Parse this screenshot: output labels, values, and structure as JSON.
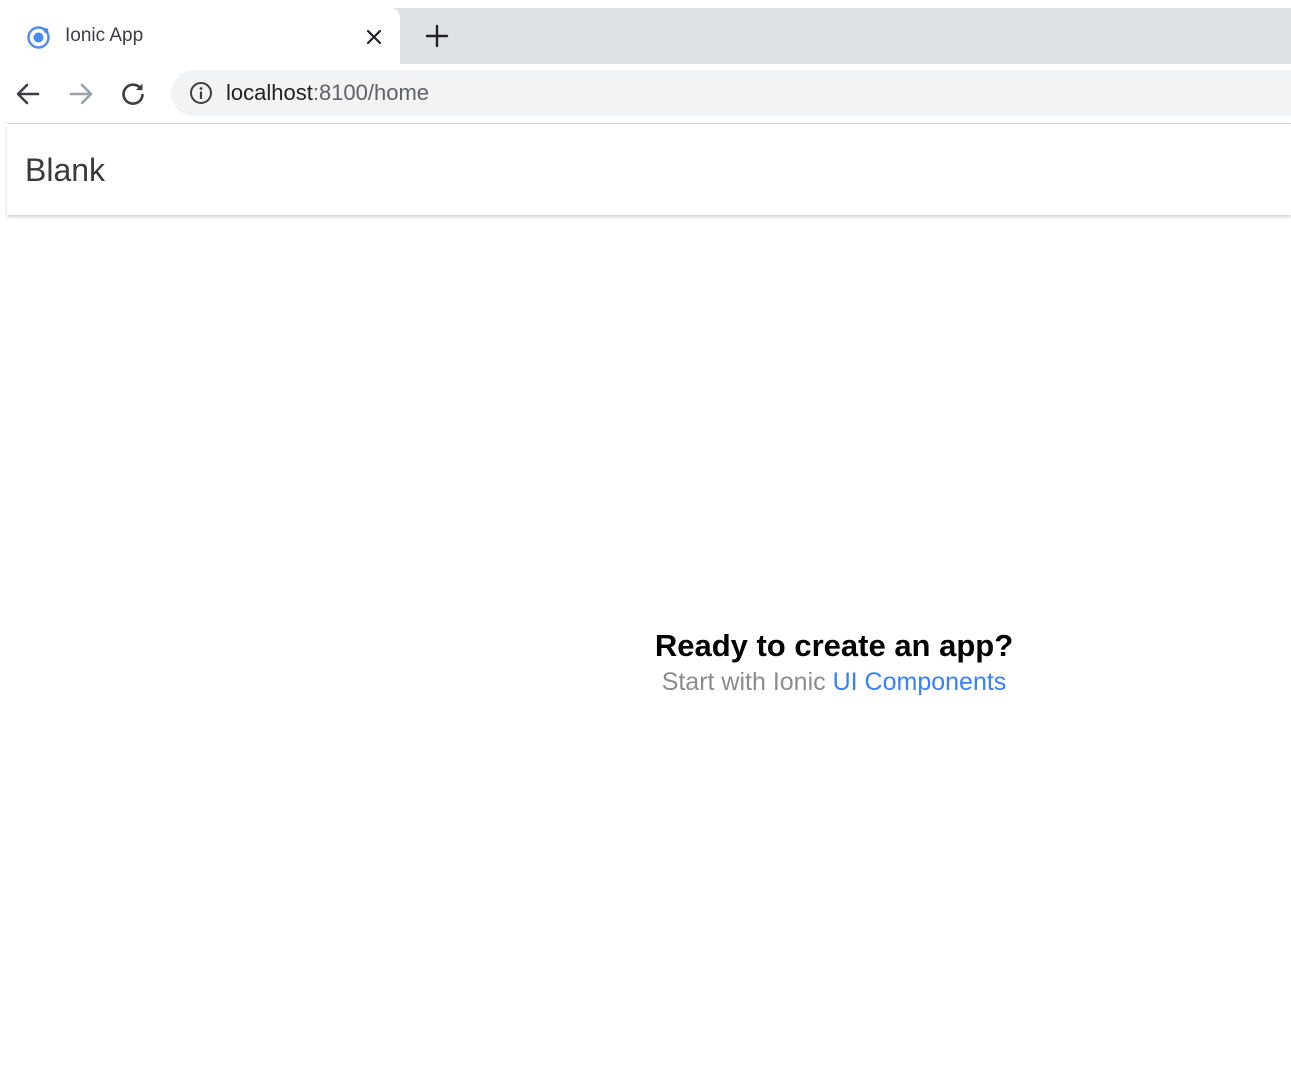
{
  "browser": {
    "tab": {
      "title": "Ionic App",
      "favicon": "ionic-logo-icon",
      "close_icon": "close-icon"
    },
    "new_tab_icon": "plus-icon",
    "nav": {
      "back_icon": "arrow-left-icon",
      "forward_icon": "arrow-right-icon",
      "reload_icon": "reload-icon"
    },
    "address_bar": {
      "info_icon": "info-icon",
      "host": "localhost",
      "path": ":8100/home"
    }
  },
  "app": {
    "header": {
      "title": "Blank"
    },
    "content": {
      "headline": "Ready to create an app?",
      "subline_prefix": "Start with Ionic ",
      "link_label": "UI Components"
    }
  },
  "colors": {
    "tab_strip": "#dee1e6",
    "omnibox": "#f1f3f4",
    "ionic_blue": "#3880ff",
    "muted_text": "#8c8c8c"
  }
}
